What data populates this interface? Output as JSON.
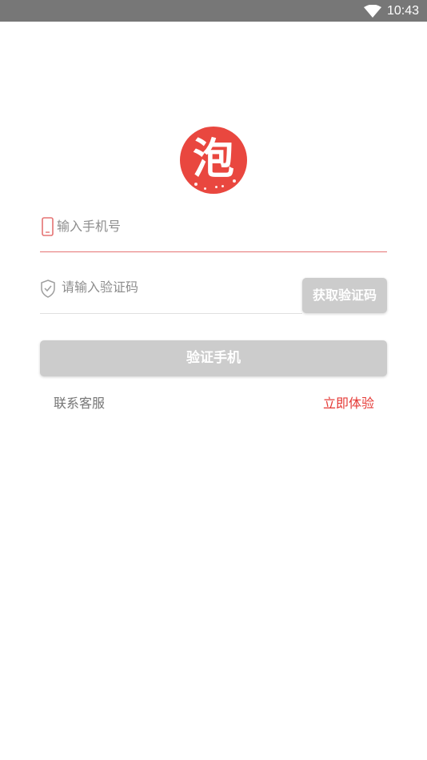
{
  "status_bar": {
    "time": "10:43",
    "icons": [
      "wifi-icon"
    ]
  },
  "logo": {
    "glyph": "泡",
    "color": "#e9473f"
  },
  "phone_field": {
    "placeholder": "输入手机号",
    "value": "",
    "icon": "phone-icon",
    "underline_color": "#e57373"
  },
  "code_field": {
    "placeholder": "请输入验证码",
    "value": "",
    "icon": "shield-check-icon",
    "get_code_label": "获取验证码"
  },
  "verify_button": {
    "label": "验证手机",
    "color": "#cccccc"
  },
  "links": {
    "support": "联系客服",
    "trial": "立即体验",
    "trial_color": "#e53935"
  }
}
